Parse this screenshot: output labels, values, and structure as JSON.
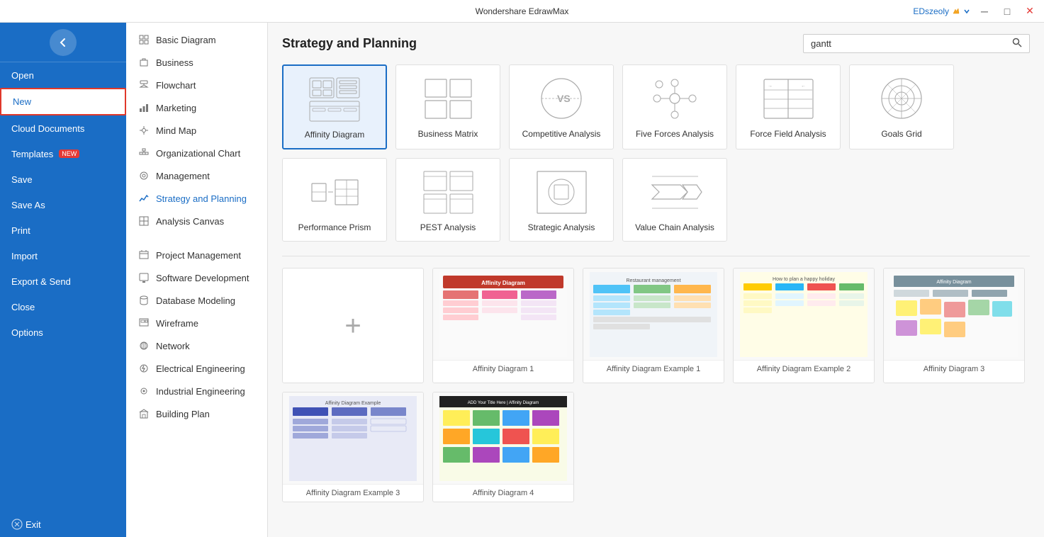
{
  "titleBar": {
    "appName": "Wondershare EdrawMax",
    "userLabel": "EDszeoly",
    "minBtn": "─",
    "maxBtn": "□",
    "closeBtn": "✕"
  },
  "sidebar": {
    "items": [
      {
        "id": "open",
        "label": "Open",
        "active": false
      },
      {
        "id": "new",
        "label": "New",
        "active": true
      },
      {
        "id": "cloud",
        "label": "Cloud Documents",
        "active": false
      },
      {
        "id": "templates",
        "label": "Templates",
        "badge": "NEW",
        "active": false
      },
      {
        "id": "save",
        "label": "Save",
        "active": false
      },
      {
        "id": "save-as",
        "label": "Save As",
        "active": false
      },
      {
        "id": "print",
        "label": "Print",
        "active": false
      },
      {
        "id": "import",
        "label": "Import",
        "active": false
      },
      {
        "id": "export",
        "label": "Export & Send",
        "active": false
      },
      {
        "id": "close",
        "label": "Close",
        "active": false
      },
      {
        "id": "options",
        "label": "Options",
        "active": false
      },
      {
        "id": "exit",
        "label": "Exit",
        "active": false
      }
    ]
  },
  "categoryNav": {
    "primary": [
      {
        "id": "basic",
        "label": "Basic Diagram",
        "icon": "◻"
      },
      {
        "id": "business",
        "label": "Business",
        "icon": "💼"
      },
      {
        "id": "flowchart",
        "label": "Flowchart",
        "icon": "⬦"
      },
      {
        "id": "marketing",
        "label": "Marketing",
        "icon": "📊"
      },
      {
        "id": "mindmap",
        "label": "Mind Map",
        "icon": "🔗"
      },
      {
        "id": "org",
        "label": "Organizational Chart",
        "icon": "🗂"
      },
      {
        "id": "management",
        "label": "Management",
        "icon": "⚙"
      },
      {
        "id": "strategy",
        "label": "Strategy and Planning",
        "icon": "📈",
        "active": true
      },
      {
        "id": "analysis",
        "label": "Analysis Canvas",
        "icon": "▦"
      }
    ],
    "secondary": [
      {
        "id": "project",
        "label": "Project Management",
        "icon": "📋"
      },
      {
        "id": "software",
        "label": "Software Development",
        "icon": "💻"
      },
      {
        "id": "database",
        "label": "Database Modeling",
        "icon": "🗄"
      },
      {
        "id": "wireframe",
        "label": "Wireframe",
        "icon": "◻"
      },
      {
        "id": "network",
        "label": "Network",
        "icon": "🌐"
      },
      {
        "id": "electrical",
        "label": "Electrical Engineering",
        "icon": "⚡"
      },
      {
        "id": "industrial",
        "label": "Industrial Engineering",
        "icon": "⚙"
      },
      {
        "id": "building",
        "label": "Building Plan",
        "icon": "🏗"
      }
    ]
  },
  "mainPanel": {
    "title": "Strategy and Planning",
    "searchPlaceholder": "gantt",
    "diagramTypes": [
      {
        "id": "affinity",
        "label": "Affinity Diagram",
        "selected": true
      },
      {
        "id": "business-matrix",
        "label": "Business Matrix",
        "selected": false
      },
      {
        "id": "competitive",
        "label": "Competitive Analysis",
        "selected": false
      },
      {
        "id": "five-forces",
        "label": "Five Forces Analysis",
        "selected": false
      },
      {
        "id": "force-field",
        "label": "Force Field Analysis",
        "selected": false
      },
      {
        "id": "goals-grid",
        "label": "Goals Grid",
        "selected": false
      },
      {
        "id": "performance-prism",
        "label": "Performance Prism",
        "selected": false
      },
      {
        "id": "pest",
        "label": "PEST Analysis",
        "selected": false
      },
      {
        "id": "strategic",
        "label": "Strategic Analysis",
        "selected": false
      },
      {
        "id": "value-chain",
        "label": "Value Chain Analysis",
        "selected": false
      }
    ],
    "templates": [
      {
        "id": "new-blank",
        "label": "",
        "type": "new"
      },
      {
        "id": "affinity1",
        "label": "Affinity Diagram 1",
        "type": "template",
        "color": "#c0392b"
      },
      {
        "id": "affinity-ex1",
        "label": "Affinity Diagram Example 1",
        "type": "template",
        "color": "#3498db"
      },
      {
        "id": "affinity-ex2",
        "label": "Affinity Diagram Example 2",
        "type": "template",
        "color": "#f39c12"
      },
      {
        "id": "affinity3",
        "label": "Affinity Diagram 3",
        "type": "template",
        "color": "#7f8c8d"
      },
      {
        "id": "affinity-ex3",
        "label": "Affinity Diagram Example 3",
        "type": "template",
        "color": "#2980b9"
      },
      {
        "id": "affinity4",
        "label": "Affinity Diagram 4",
        "type": "template",
        "color": "#27ae60"
      }
    ]
  }
}
